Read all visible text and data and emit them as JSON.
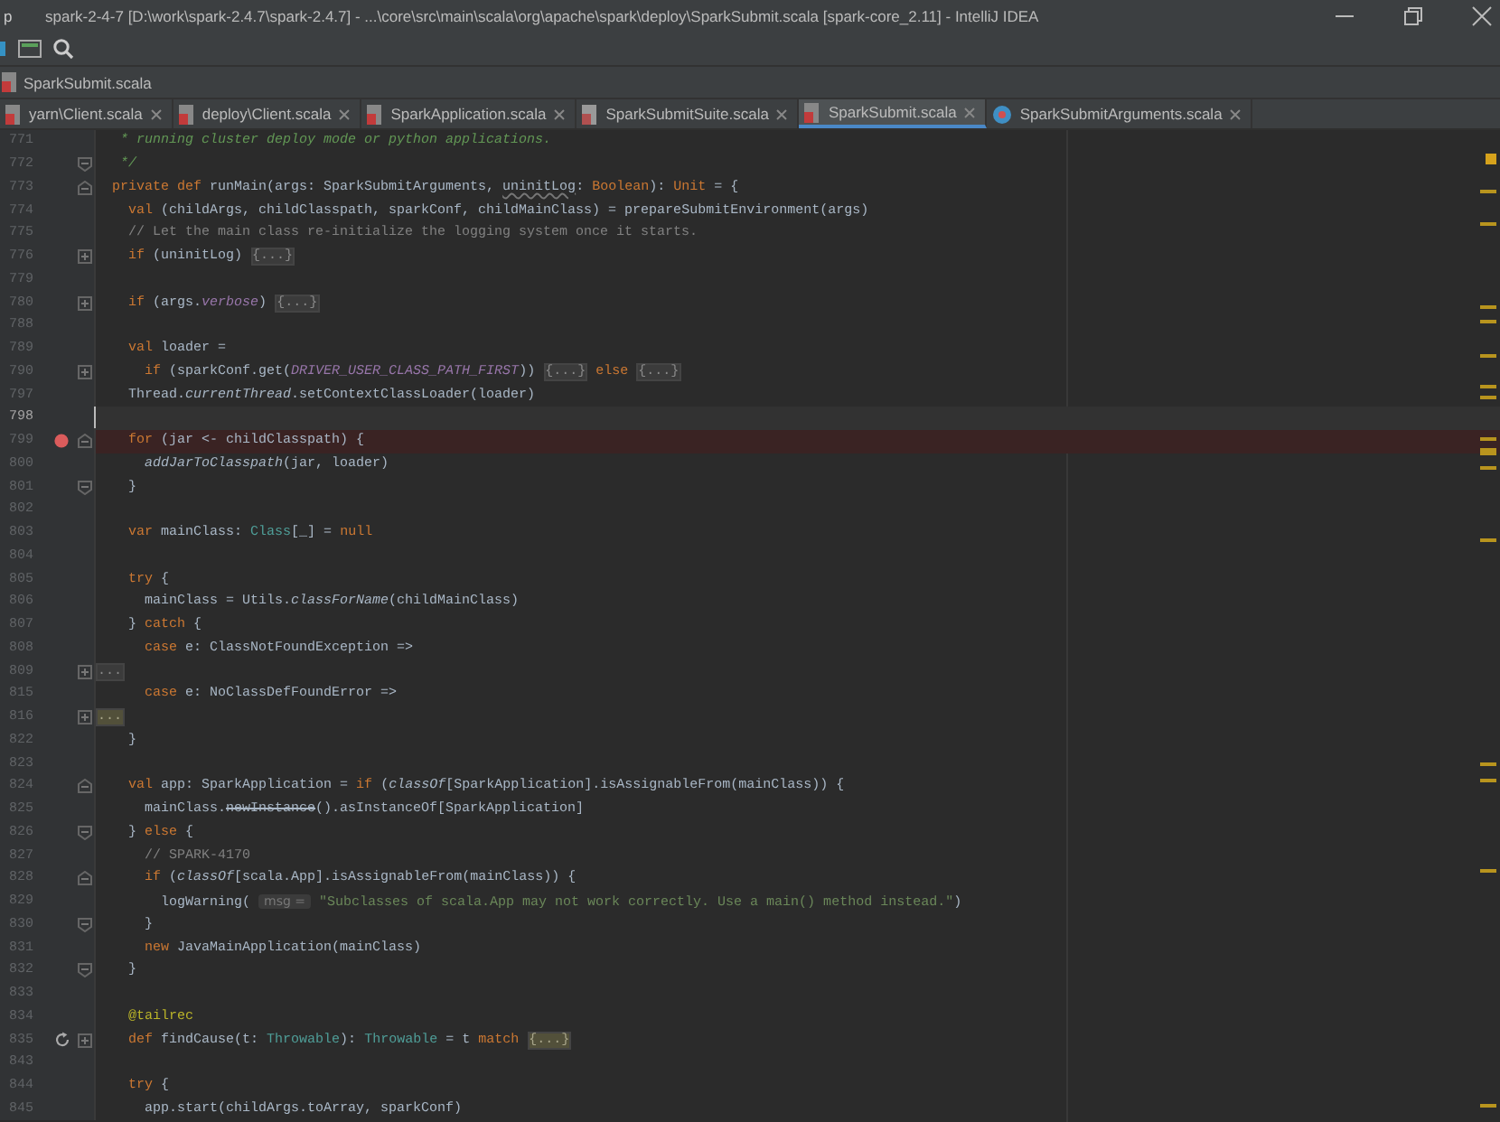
{
  "window": {
    "menu_fragment": "p",
    "title": "spark-2-4-7 [D:\\work\\spark-2.4.7\\spark-2.4.7] - ...\\core\\src\\main\\scala\\org\\apache\\spark\\deploy\\SparkSubmit.scala [spark-core_2.11] - IntelliJ IDEA"
  },
  "breadcrumb": "SparkSubmit.scala",
  "tabs": [
    {
      "label": "yarn\\Client.scala",
      "kind": "scala",
      "selected": false
    },
    {
      "label": "deploy\\Client.scala",
      "kind": "scala",
      "selected": false
    },
    {
      "label": "SparkApplication.scala",
      "kind": "scala",
      "selected": false
    },
    {
      "label": "SparkSubmitSuite.scala",
      "kind": "test",
      "selected": false
    },
    {
      "label": "SparkSubmit.scala",
      "kind": "scala",
      "selected": true
    },
    {
      "label": "SparkSubmitArguments.scala",
      "kind": "object",
      "selected": false
    }
  ],
  "lines": [
    {
      "number": "771",
      "tokens": [
        {
          "kind": "doc",
          "text": "   * running cluster deploy mode or python applications."
        }
      ]
    },
    {
      "number": "772",
      "gutter": [
        {
          "kind": "fold_end"
        }
      ],
      "tokens": [
        {
          "kind": "doc",
          "text": "   */"
        }
      ]
    },
    {
      "number": "773",
      "gutter": [
        {
          "kind": "fold_start"
        }
      ],
      "tokens": [
        {
          "kind": "kw",
          "text": "  private def "
        },
        {
          "kind": "p",
          "text": "runMain(args: SparkSubmitArguments, "
        },
        {
          "kind": "warn",
          "text": "uninitLog"
        },
        {
          "kind": "p",
          "text": ": "
        },
        {
          "kind": "kw",
          "text": "Boolean"
        },
        {
          "kind": "p",
          "text": "): "
        },
        {
          "kind": "kw",
          "text": "Unit"
        },
        {
          "kind": "p",
          "text": " = {"
        }
      ]
    },
    {
      "number": "774",
      "tokens": [
        {
          "kind": "kw",
          "text": "    val "
        },
        {
          "kind": "p",
          "text": "(childArgs, childClasspath, sparkConf, childMainClass) = prepareSubmitEnvironment(args)"
        }
      ]
    },
    {
      "number": "775",
      "tokens": [
        {
          "kind": "cm",
          "text": "    // Let the main class re-initialize the logging system once it starts."
        }
      ]
    },
    {
      "number": "776",
      "gutter": [
        {
          "kind": "fold_collapsed"
        }
      ],
      "tokens": [
        {
          "kind": "kw",
          "text": "    if "
        },
        {
          "kind": "p",
          "text": "(uninitLog) "
        },
        {
          "kind": "fold",
          "text": "{...}"
        }
      ]
    },
    {
      "number": "779"
    },
    {
      "number": "780",
      "gutter": [
        {
          "kind": "fold_collapsed"
        }
      ],
      "tokens": [
        {
          "kind": "kw",
          "text": "    if "
        },
        {
          "kind": "p",
          "text": "(args."
        },
        {
          "kind": "const",
          "text": "verbose"
        },
        {
          "kind": "p",
          "text": ") "
        },
        {
          "kind": "fold",
          "text": "{...}"
        }
      ]
    },
    {
      "number": "788"
    },
    {
      "number": "789",
      "tokens": [
        {
          "kind": "kw",
          "text": "    val "
        },
        {
          "kind": "p",
          "text": "loader ="
        }
      ]
    },
    {
      "number": "790",
      "gutter": [
        {
          "kind": "fold_collapsed"
        }
      ],
      "tokens": [
        {
          "kind": "kw",
          "text": "      if "
        },
        {
          "kind": "p",
          "text": "(sparkConf.get("
        },
        {
          "kind": "const",
          "text": "DRIVER_USER_CLASS_PATH_FIRST"
        },
        {
          "kind": "p",
          "text": ")) "
        },
        {
          "kind": "fold",
          "text": "{...}"
        },
        {
          "kind": "kw",
          "text": " else "
        },
        {
          "kind": "fold",
          "text": "{...}"
        }
      ]
    },
    {
      "number": "797",
      "tokens": [
        {
          "kind": "p",
          "text": "    Thread."
        },
        {
          "kind": "it",
          "text": "currentThread"
        },
        {
          "kind": "p",
          "text": ".setContextClassLoader(loader)"
        }
      ]
    },
    {
      "number": "798",
      "current": true
    },
    {
      "number": "799",
      "gutter": [
        {
          "kind": "breakpoint"
        },
        {
          "kind": "fold_start"
        }
      ],
      "tokens": [
        {
          "kind": "kw",
          "text": "    for "
        },
        {
          "kind": "p",
          "text": "(jar <- childClasspath) {"
        }
      ]
    },
    {
      "number": "800",
      "tokens": [
        {
          "kind": "it",
          "text": "      addJarToClasspath"
        },
        {
          "kind": "p",
          "text": "(jar, loader)"
        }
      ]
    },
    {
      "number": "801",
      "gutter": [
        {
          "kind": "fold_end"
        }
      ],
      "tokens": [
        {
          "kind": "p",
          "text": "    }"
        }
      ]
    },
    {
      "number": "802"
    },
    {
      "number": "803",
      "tokens": [
        {
          "kind": "kw",
          "text": "    var "
        },
        {
          "kind": "p",
          "text": "mainClass: "
        },
        {
          "kind": "ty",
          "text": "Class"
        },
        {
          "kind": "p",
          "text": "[_] = "
        },
        {
          "kind": "kw",
          "text": "null"
        }
      ]
    },
    {
      "number": "804"
    },
    {
      "number": "805",
      "tokens": [
        {
          "kind": "kw",
          "text": "    try "
        },
        {
          "kind": "p",
          "text": "{"
        }
      ]
    },
    {
      "number": "806",
      "tokens": [
        {
          "kind": "p",
          "text": "      mainClass = Utils."
        },
        {
          "kind": "it",
          "text": "classForName"
        },
        {
          "kind": "p",
          "text": "(childMainClass)"
        }
      ]
    },
    {
      "number": "807",
      "tokens": [
        {
          "kind": "p",
          "text": "    } "
        },
        {
          "kind": "kw",
          "text": "catch "
        },
        {
          "kind": "p",
          "text": "{"
        }
      ]
    },
    {
      "number": "808",
      "tokens": [
        {
          "kind": "kw",
          "text": "      case "
        },
        {
          "kind": "p",
          "text": "e: ClassNotFoundException =>"
        }
      ]
    },
    {
      "number": "809",
      "gutter": [
        {
          "kind": "fold_collapsed"
        }
      ],
      "tokens": [
        {
          "kind": "fold",
          "text": "..."
        }
      ]
    },
    {
      "number": "815",
      "tokens": [
        {
          "kind": "kw",
          "text": "      case "
        },
        {
          "kind": "p",
          "text": "e: NoClassDefFoundError =>"
        }
      ]
    },
    {
      "number": "816",
      "gutter": [
        {
          "kind": "fold_collapsed"
        }
      ],
      "tokens": [
        {
          "kind": "fold_hl",
          "text": "..."
        }
      ]
    },
    {
      "number": "822",
      "tokens": [
        {
          "kind": "p",
          "text": "    }"
        }
      ]
    },
    {
      "number": "823"
    },
    {
      "number": "824",
      "gutter": [
        {
          "kind": "fold_start"
        }
      ],
      "tokens": [
        {
          "kind": "kw",
          "text": "    val "
        },
        {
          "kind": "p",
          "text": "app: SparkApplication = "
        },
        {
          "kind": "kw",
          "text": "if "
        },
        {
          "kind": "p",
          "text": "("
        },
        {
          "kind": "it",
          "text": "classOf"
        },
        {
          "kind": "p",
          "text": "[SparkApplication].isAssignableFrom(mainClass)) {"
        }
      ]
    },
    {
      "number": "825",
      "tokens": [
        {
          "kind": "p",
          "text": "      mainClass."
        },
        {
          "kind": "strike",
          "text": "newInstance"
        },
        {
          "kind": "p",
          "text": "().asInstanceOf[SparkApplication]"
        }
      ]
    },
    {
      "number": "826",
      "gutter": [
        {
          "kind": "fold_end"
        }
      ],
      "tokens": [
        {
          "kind": "p",
          "text": "    } "
        },
        {
          "kind": "kw",
          "text": "else "
        },
        {
          "kind": "p",
          "text": "{"
        }
      ]
    },
    {
      "number": "827",
      "tokens": [
        {
          "kind": "cm",
          "text": "      // SPARK-4170"
        }
      ]
    },
    {
      "number": "828",
      "gutter": [
        {
          "kind": "fold_start"
        }
      ],
      "tokens": [
        {
          "kind": "kw",
          "text": "      if "
        },
        {
          "kind": "p",
          "text": "("
        },
        {
          "kind": "it",
          "text": "classOf"
        },
        {
          "kind": "p",
          "text": "[scala.App].isAssignableFrom(mainClass)) {"
        }
      ]
    },
    {
      "number": "829",
      "tokens": [
        {
          "kind": "p",
          "text": "        logWarning( "
        },
        {
          "kind": "hint",
          "text": "msg ="
        },
        {
          "kind": "str",
          "text": " \"Subclasses of scala.App may not work correctly. Use a main() method instead.\""
        },
        {
          "kind": "p",
          "text": ")"
        }
      ]
    },
    {
      "number": "830",
      "gutter": [
        {
          "kind": "fold_end"
        }
      ],
      "tokens": [
        {
          "kind": "p",
          "text": "      }"
        }
      ]
    },
    {
      "number": "831",
      "tokens": [
        {
          "kind": "kw",
          "text": "      new "
        },
        {
          "kind": "p",
          "text": "JavaMainApplication(mainClass)"
        }
      ]
    },
    {
      "number": "832",
      "gutter": [
        {
          "kind": "fold_end"
        }
      ],
      "tokens": [
        {
          "kind": "p",
          "text": "    }"
        }
      ]
    },
    {
      "number": "833"
    },
    {
      "number": "834",
      "tokens": [
        {
          "kind": "ann",
          "text": "    @tailrec"
        }
      ]
    },
    {
      "number": "835",
      "gutter": [
        {
          "kind": "recursion"
        },
        {
          "kind": "fold_collapsed"
        }
      ],
      "tokens": [
        {
          "kind": "kw",
          "text": "    def "
        },
        {
          "kind": "p",
          "text": "findCause(t: "
        },
        {
          "kind": "ty",
          "text": "Throwable"
        },
        {
          "kind": "p",
          "text": "): "
        },
        {
          "kind": "ty",
          "text": "Throwable"
        },
        {
          "kind": "p",
          "text": " = t "
        },
        {
          "kind": "kw",
          "text": "match "
        },
        {
          "kind": "fold_hl",
          "text": "{...}"
        }
      ]
    },
    {
      "number": "843"
    },
    {
      "number": "844",
      "tokens": [
        {
          "kind": "kw",
          "text": "    try "
        },
        {
          "kind": "p",
          "text": "{"
        }
      ]
    },
    {
      "number": "845",
      "tokens": [
        {
          "kind": "p",
          "text": "      app.start(childArgs.toArray, sparkConf)"
        }
      ]
    }
  ]
}
